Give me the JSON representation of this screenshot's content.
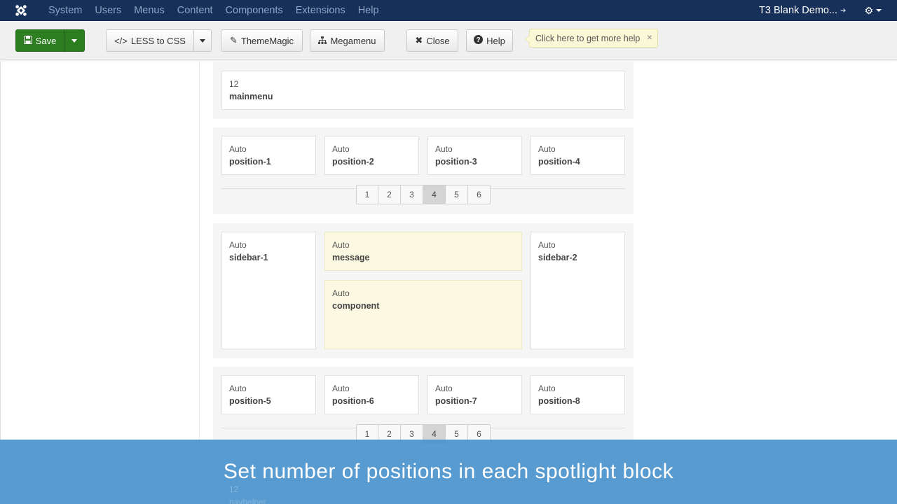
{
  "topnav": {
    "items": [
      "System",
      "Users",
      "Menus",
      "Content",
      "Components",
      "Extensions",
      "Help"
    ],
    "site_name": "T3 Blank Demo..."
  },
  "toolbar": {
    "save_label": "Save",
    "less_label": "LESS to CSS",
    "thememagic_label": "ThemeMagic",
    "megamenu_label": "Megamenu",
    "close_label": "Close",
    "help_label": "Help",
    "help_tip": "Click here to get more help"
  },
  "layout": {
    "mainmenu": {
      "size": "12",
      "name": "mainmenu"
    },
    "spotlight1": [
      {
        "size": "Auto",
        "name": "position-1"
      },
      {
        "size": "Auto",
        "name": "position-2"
      },
      {
        "size": "Auto",
        "name": "position-3"
      },
      {
        "size": "Auto",
        "name": "position-4"
      }
    ],
    "main": [
      {
        "size": "Auto",
        "name": "sidebar-1"
      },
      {
        "size": "Auto",
        "name": "message"
      },
      {
        "size": "Auto",
        "name": "component"
      },
      {
        "size": "Auto",
        "name": "sidebar-2"
      }
    ],
    "spotlight2": [
      {
        "size": "Auto",
        "name": "position-5"
      },
      {
        "size": "Auto",
        "name": "position-6"
      },
      {
        "size": "Auto",
        "name": "position-7"
      },
      {
        "size": "Auto",
        "name": "position-8"
      }
    ],
    "pager_numbers": [
      "1",
      "2",
      "3",
      "4",
      "5",
      "6"
    ],
    "pager_active": "4",
    "hidden_block": {
      "size": "12",
      "name": "navhelper"
    }
  },
  "caption": "Set number of positions in each spotlight block",
  "colors": {
    "navbar": "#173059",
    "save": "#2b7d1f",
    "caption": "#4a92cd",
    "highlight": "#fcf9e2"
  }
}
